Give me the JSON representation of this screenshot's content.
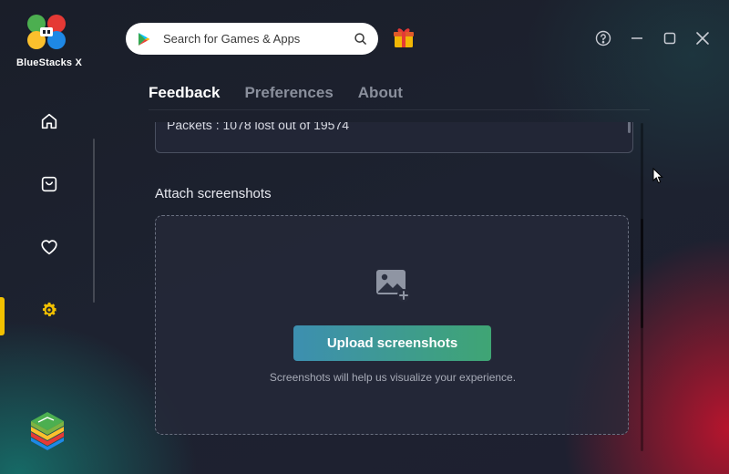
{
  "app": {
    "brand": "BlueStacks X"
  },
  "search": {
    "placeholder": "Search for Games & Apps"
  },
  "tabs": [
    {
      "label": "Feedback",
      "active": true
    },
    {
      "label": "Preferences",
      "active": false
    },
    {
      "label": "About",
      "active": false
    }
  ],
  "sidebar": {
    "items": [
      {
        "icon": "home-icon"
      },
      {
        "icon": "my-games-icon"
      },
      {
        "icon": "heart-icon"
      },
      {
        "icon": "gear-icon",
        "active": true
      }
    ]
  },
  "feedback": {
    "packets_text": "Packets  :  1078 lost out of 19574",
    "attach_label": "Attach screenshots",
    "upload_button": "Upload screenshots",
    "hint": "Screenshots will help us visualize your experience."
  },
  "colors": {
    "accent_yellow": "#f2c100",
    "button_start": "#3d8fb0",
    "button_end": "#3fa574"
  }
}
